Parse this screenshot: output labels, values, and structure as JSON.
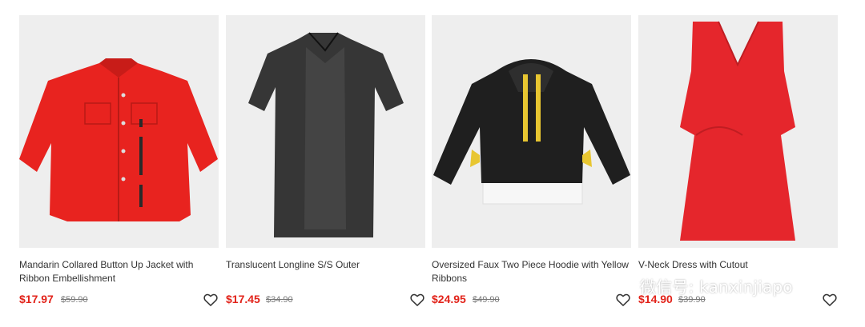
{
  "products": [
    {
      "title": "Mandarin Collared Button Up Jacket with Ribbon Embellishment",
      "price": "$17.97",
      "original_price": "$59.90"
    },
    {
      "title": "Translucent Longline S/S Outer",
      "price": "$17.45",
      "original_price": "$34.90"
    },
    {
      "title": "Oversized Faux Two Piece Hoodie with Yellow Ribbons",
      "price": "$24.95",
      "original_price": "$49.90"
    },
    {
      "title": "V-Neck Dress with Cutout",
      "price": "$14.90",
      "original_price": "$39.90"
    }
  ],
  "watermark": {
    "text": "微信号: kanxinjiapo",
    "icon": "wechat-icon"
  },
  "icons": {
    "wishlist": "heart-icon"
  },
  "colors": {
    "sale_price": "#e2231a",
    "image_background": "#eeeeee",
    "title_text": "#333333"
  }
}
